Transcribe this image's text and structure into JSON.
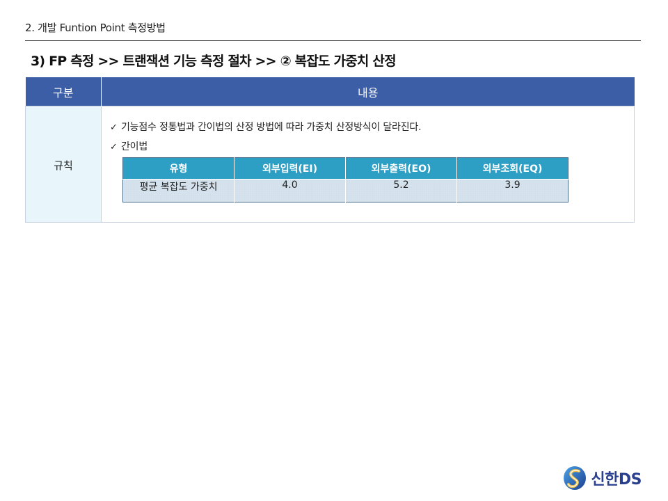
{
  "header": {
    "section_title": "2. 개발 Funtion Point 측정방법",
    "heading": "3) FP 측정 >> 트랜잭션 기능 측정 절차 >> ② 복잡도 가중치 산정"
  },
  "main_table": {
    "col_headers": [
      "구분",
      "내용"
    ],
    "row_label": "규칙",
    "lines": [
      "기능점수 정통법과 간이법의 산정 방법에 따라 가중치 산정방식이 달라진다.",
      "간이법"
    ],
    "check_icon": "✓"
  },
  "weight_table": {
    "headers": [
      "유형",
      "외부입력(EI)",
      "외부출력(EO)",
      "외부조회(EQ)"
    ],
    "row": [
      "평균 복잡도 가중치",
      "4.0",
      "5.2",
      "3.9"
    ]
  },
  "logo": {
    "text": "신한DS",
    "icon": "shinhan-s-logo-icon"
  },
  "colors": {
    "header_blue": "#3c5ea7",
    "inner_header_teal": "#2e9fc4",
    "label_cell_bg": "#e8f5fa",
    "inner_row_bg": "#d6e3ee"
  }
}
